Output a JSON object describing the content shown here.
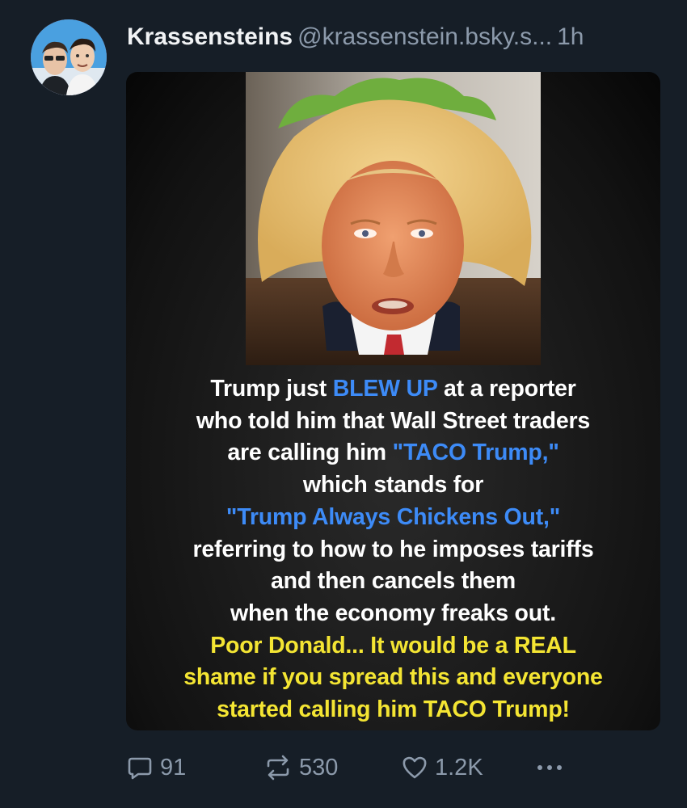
{
  "post": {
    "author_name": "Krassensteins",
    "author_handle": "@krassenstein.bsky.s...",
    "time": "1h",
    "image_text": {
      "line1_a": "Trump just ",
      "line1_b": "BLEW UP",
      "line1_c": " at a reporter",
      "line2": "who told him that Wall Street traders",
      "line3_a": "are calling him ",
      "line3_b": "\"TACO Trump,\"",
      "line4": "which stands for",
      "line5": "\"Trump Always Chickens Out,\"",
      "line6": "referring to how to he imposes tariffs",
      "line7": "and then cancels them",
      "line8": "when the economy freaks out.",
      "line9": "Poor Donald... It would be a REAL",
      "line10": "shame if you spread this and everyone",
      "line11": "started calling him TACO Trump!"
    }
  },
  "actions": {
    "replies": "91",
    "reposts": "530",
    "likes": "1.2K"
  },
  "icons": {
    "reply": "reply-icon",
    "repost": "repost-icon",
    "like": "heart-icon",
    "more": "more-icon"
  },
  "colors": {
    "background": "#161e27",
    "highlight_blue": "#3d8bf7",
    "highlight_yellow": "#f4e533",
    "muted": "#8c9aab"
  }
}
